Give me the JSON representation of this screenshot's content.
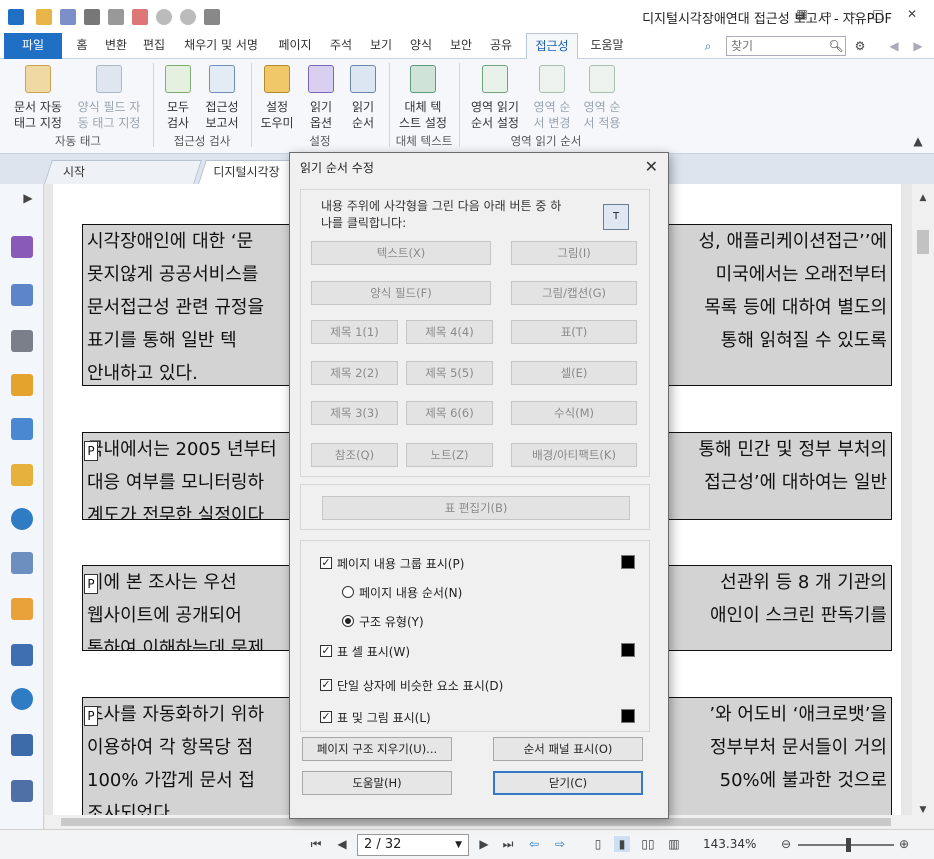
{
  "window": {
    "title": "디지털시각장애연대 접근성 보고서 - 자유PDF"
  },
  "menu": {
    "tabs": [
      "파일",
      "홈",
      "변환",
      "편집",
      "채우기 및 서명",
      "페이지",
      "주석",
      "보기",
      "양식",
      "보안",
      "공유",
      "접근성",
      "도움말"
    ],
    "active": "접근성",
    "find_placeholder": "찾기"
  },
  "ribbon": {
    "buttons": [
      {
        "label1": "문서 자동",
        "label2": "태그 지정"
      },
      {
        "label1": "양식 필드 자",
        "label2": "동 태그 지정"
      },
      {
        "label1": "모두",
        "label2": "검사"
      },
      {
        "label1": "접근성",
        "label2": "보고서"
      },
      {
        "label1": "설정",
        "label2": "도우미"
      },
      {
        "label1": "읽기",
        "label2": "옵션"
      },
      {
        "label1": "읽기",
        "label2": "순서"
      },
      {
        "label1": "대체 텍",
        "label2": "스트 설정"
      },
      {
        "label1": "영역 읽기",
        "label2": "순서 설정"
      },
      {
        "label1": "영역 순",
        "label2": "서 변경"
      },
      {
        "label1": "영역 순",
        "label2": "서 적용"
      }
    ],
    "groups": [
      "자동 태그",
      "접근성 검사",
      "설정",
      "대체 텍스트",
      "영역 읽기 순서"
    ]
  },
  "doc_tabs": [
    "시작",
    "디지털시각장애"
  ],
  "document": {
    "paragraphs": [
      {
        "lines": [
          "시각장애인에 대한 ‘문",
          "못지않게 공공서비스를",
          "문서접근성 관련 규정을",
          "표기를 통해 일반 텍",
          "안내하고 있다."
        ],
        "right": [
          "성, 애플리케이션접근’’에",
          "미국에서는 오래전부터",
          "목록 등에 대하여 별도의",
          "통해 읽혀질 수 있도록",
          ""
        ]
      },
      {
        "lines": [
          "국내에서는 2005 년부터",
          "대응 여부를 모니터링하",
          "계도가 전무한 실정이다"
        ],
        "right": [
          "통해 민간 및 정부 부처의",
          "접근성’에 대하여는 일반",
          ""
        ]
      },
      {
        "lines": [
          "이에 본 조사는 우선",
          "웹사이트에 공개되어",
          "통하여 이해하는데 문제"
        ],
        "right": [
          "선관위 등 8 개 기관의",
          "애인이 스크린 판독기를",
          ""
        ]
      },
      {
        "lines": [
          "조사를 자동화하기 위하",
          "이용하여 각 항목당 점",
          "100% 가깝게 문서 접",
          "조사되었다."
        ],
        "right": [
          "’와 어도비 ‘애크로뱃’을",
          "정부부처 문서들이 거의",
          "50%에 불과한 것으로",
          ""
        ]
      }
    ],
    "tag_label": "P"
  },
  "dialog": {
    "title": "읽기 순서 수정",
    "instruction1": "내용 주위에 사각형을 그린 다음 아래 버튼 중 하",
    "instruction2": "나를 클릭합니다:",
    "buttons": [
      "텍스트(X)",
      "그림(I)",
      "양식 필드(F)",
      "그림/캡션(G)",
      "제목 1(1)",
      "제목 4(4)",
      "표(T)",
      "제목 2(2)",
      "제목 5(5)",
      "셀(E)",
      "제목 3(3)",
      "제목 6(6)",
      "수식(M)",
      "참조(Q)",
      "노트(Z)",
      "배경/아티팩트(K)"
    ],
    "table_editor": "표 편집기(B)",
    "options": {
      "show_groups": "페이지 내용 그룹 표시(P)",
      "page_order": "페이지 내용 순서(N)",
      "structure_type": "구조 유형(Y)",
      "show_cells": "표 셀 표시(W)",
      "show_single_box": "단일 상자에 비슷한 요소 표시(D)",
      "show_tables_figures": "표 및 그림 표시(L)"
    },
    "clear_structure": "페이지 구조 지우기(U)...",
    "show_order_panel": "순서 패널 표시(O)",
    "help": "도움말(H)",
    "close": "닫기(C)"
  },
  "status": {
    "page": "2 / 32",
    "zoom": "143.34%"
  },
  "colors": {
    "accent": "#1f6fc5",
    "tag_bg": "#d3d3d3",
    "swatch": "#000000"
  }
}
